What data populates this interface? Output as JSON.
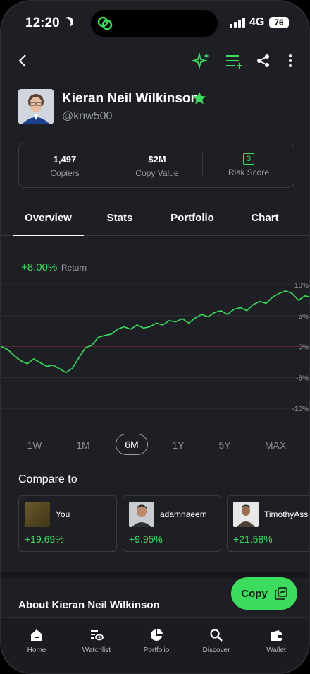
{
  "status": {
    "time": "12:20",
    "network": "4G",
    "battery": "76"
  },
  "profile": {
    "name": "Kieran Neil Wilkinson",
    "handle": "@knw500"
  },
  "stats": [
    {
      "value": "1,497",
      "label": "Copiers"
    },
    {
      "value": "$2M",
      "label": "Copy Value"
    },
    {
      "value": "3",
      "label": "Risk Score"
    }
  ],
  "tabs": [
    {
      "label": "Overview",
      "active": true
    },
    {
      "label": "Stats"
    },
    {
      "label": "Portfolio"
    },
    {
      "label": "Chart"
    }
  ],
  "chart": {
    "return_value": "+8.00%",
    "return_label": "Return",
    "y_ticks": [
      "10%",
      "5%",
      "0%",
      "-5%",
      "-10%"
    ]
  },
  "chart_data": {
    "type": "line",
    "ylim": [
      -10,
      10
    ],
    "series": [
      {
        "values": [
          0.0,
          -0.5,
          -1.5,
          -2.3,
          -2.8,
          -2.0,
          -2.6,
          -3.2,
          -3.0,
          -3.6,
          -4.2,
          -3.5,
          -1.8,
          -0.2,
          0.2,
          1.5,
          1.8,
          2.0,
          2.8,
          3.2,
          2.8,
          3.5,
          3.0,
          3.2,
          3.8,
          3.5,
          4.2,
          4.0,
          4.5,
          3.8,
          4.6,
          5.2,
          4.8,
          5.5,
          5.8,
          5.2,
          6.0,
          6.3,
          5.8,
          6.8,
          7.3,
          7.0,
          8.0,
          8.6,
          9.0,
          8.6,
          7.5,
          8.2,
          8.0
        ]
      }
    ]
  },
  "ranges": [
    "1W",
    "1M",
    "6M",
    "1Y",
    "5Y",
    "MAX"
  ],
  "compare": {
    "title": "Compare to",
    "items": [
      {
        "name": "You",
        "pct": "+19.69%"
      },
      {
        "name": "adamnaeem",
        "pct": "+9.95%"
      },
      {
        "name": "TimothyAssi",
        "pct": "+21.58%"
      }
    ]
  },
  "about": {
    "title": "About Kieran Neil Wilkinson"
  },
  "copy_button": {
    "label": "Copy"
  },
  "nav": [
    {
      "label": "Home",
      "icon": "home-icon"
    },
    {
      "label": "Watchlist",
      "icon": "watchlist-icon"
    },
    {
      "label": "Portfolio",
      "icon": "pie-chart-icon"
    },
    {
      "label": "Discover",
      "icon": "search-icon"
    },
    {
      "label": "Wallet",
      "icon": "wallet-icon"
    }
  ],
  "colors": {
    "accent": "#3ddc5e",
    "background": "#1d1f24"
  }
}
